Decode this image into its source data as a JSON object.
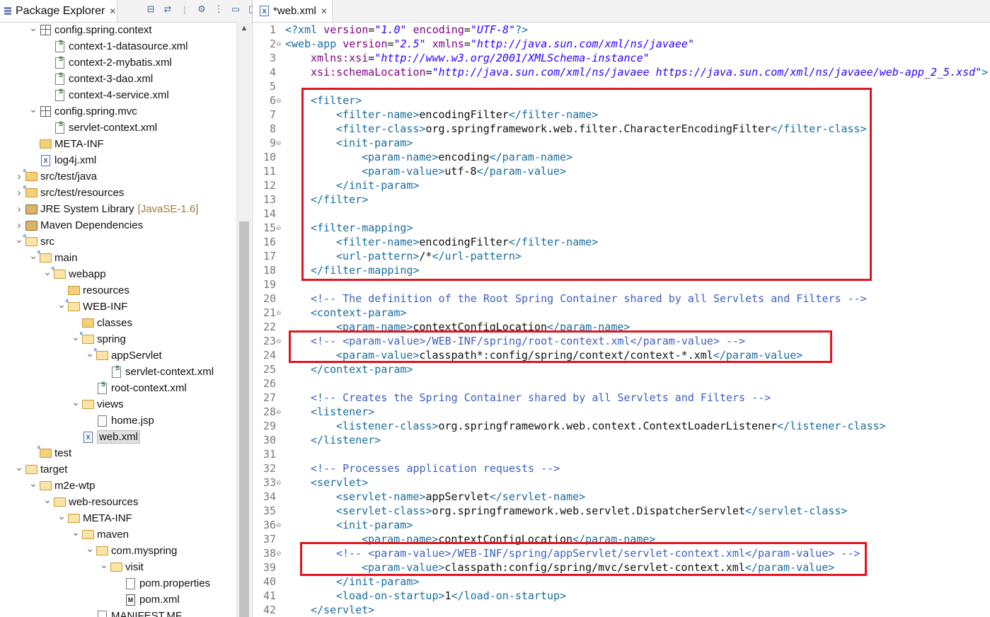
{
  "explorer": {
    "tab_label": "Package Explorer",
    "tab_close": "✕",
    "rows": [
      {
        "label": "config.spring.context",
        "indent": 1,
        "tw": "open",
        "icon": "package"
      },
      {
        "label": "context-1-datasource.xml",
        "indent": 2,
        "tw": "",
        "icon": "spring-xml"
      },
      {
        "label": "context-2-mybatis.xml",
        "indent": 2,
        "tw": "",
        "icon": "spring-xml"
      },
      {
        "label": "context-3-dao.xml",
        "indent": 2,
        "tw": "",
        "icon": "spring-xml"
      },
      {
        "label": "context-4-service.xml",
        "indent": 2,
        "tw": "",
        "icon": "spring-xml"
      },
      {
        "label": "config.spring.mvc",
        "indent": 1,
        "tw": "open",
        "icon": "package"
      },
      {
        "label": "servlet-context.xml",
        "indent": 2,
        "tw": "",
        "icon": "spring-xml"
      },
      {
        "label": "META-INF",
        "indent": 1,
        "tw": "",
        "icon": "folder"
      },
      {
        "label": "log4j.xml",
        "indent": 1,
        "tw": "",
        "icon": "xml"
      },
      {
        "label": "src/test/java",
        "indent": 0,
        "tw": "closed",
        "icon": "src-folder"
      },
      {
        "label": "src/test/resources",
        "indent": 0,
        "tw": "closed",
        "icon": "src-folder"
      },
      {
        "label": "JRE System Library",
        "deco": "[JavaSE-1.6]",
        "indent": 0,
        "tw": "closed",
        "icon": "library"
      },
      {
        "label": "Maven Dependencies",
        "indent": 0,
        "tw": "closed",
        "icon": "library"
      },
      {
        "label": "src",
        "indent": 0,
        "tw": "open",
        "icon": "src-folder"
      },
      {
        "label": "main",
        "indent": 1,
        "tw": "open",
        "icon": "src-folder"
      },
      {
        "label": "webapp",
        "indent": 2,
        "tw": "open",
        "icon": "src-folder"
      },
      {
        "label": "resources",
        "indent": 3,
        "tw": "",
        "icon": "folder"
      },
      {
        "label": "WEB-INF",
        "indent": 3,
        "tw": "open",
        "icon": "src-folder"
      },
      {
        "label": "classes",
        "indent": 4,
        "tw": "",
        "icon": "folder"
      },
      {
        "label": "spring",
        "indent": 4,
        "tw": "open",
        "icon": "src-folder"
      },
      {
        "label": "appServlet",
        "indent": 5,
        "tw": "open",
        "icon": "src-folder"
      },
      {
        "label": "servlet-context.xml",
        "indent": 6,
        "tw": "",
        "icon": "spring-xml"
      },
      {
        "label": "root-context.xml",
        "indent": 5,
        "tw": "",
        "icon": "spring-xml"
      },
      {
        "label": "views",
        "indent": 4,
        "tw": "open",
        "icon": "folder"
      },
      {
        "label": "home.jsp",
        "indent": 5,
        "tw": "",
        "icon": "jsp"
      },
      {
        "label": "web.xml",
        "indent": 4,
        "tw": "",
        "icon": "xml",
        "selected": true
      },
      {
        "label": "test",
        "indent": 1,
        "tw": "",
        "icon": "src-folder"
      },
      {
        "label": "target",
        "indent": 0,
        "tw": "open",
        "icon": "folder"
      },
      {
        "label": "m2e-wtp",
        "indent": 1,
        "tw": "open",
        "icon": "folder"
      },
      {
        "label": "web-resources",
        "indent": 2,
        "tw": "open",
        "icon": "folder"
      },
      {
        "label": "META-INF",
        "indent": 3,
        "tw": "open",
        "icon": "folder"
      },
      {
        "label": "maven",
        "indent": 4,
        "tw": "open",
        "icon": "folder"
      },
      {
        "label": "com.myspring",
        "indent": 5,
        "tw": "open",
        "icon": "folder"
      },
      {
        "label": "visit",
        "indent": 6,
        "tw": "open",
        "icon": "folder"
      },
      {
        "label": "pom.properties",
        "indent": 7,
        "tw": "",
        "icon": "file"
      },
      {
        "label": "pom.xml",
        "indent": 7,
        "tw": "",
        "icon": "maven-xml"
      },
      {
        "label": "MANIFEST.MF",
        "indent": 5,
        "tw": "",
        "icon": "file"
      }
    ]
  },
  "editor": {
    "tab_label": "*web.xml",
    "tab_close": "✕",
    "lines": [
      {
        "n": "1",
        "fold": false,
        "ind": 0,
        "segs": [
          [
            "pi",
            "<?xml "
          ],
          [
            "a",
            "version"
          ],
          [
            "",
            "="
          ],
          [
            "v",
            "\"1.0\""
          ],
          [
            "a",
            " encoding"
          ],
          [
            "",
            "="
          ],
          [
            "v",
            "\"UTF-8\""
          ],
          [
            "pi",
            "?>"
          ]
        ]
      },
      {
        "n": "2",
        "fold": true,
        "ind": 0,
        "segs": [
          [
            "t",
            "<web-app "
          ],
          [
            "a",
            "version"
          ],
          [
            "",
            "="
          ],
          [
            "v",
            "\"2.5\""
          ],
          [
            "a",
            " xmlns"
          ],
          [
            "",
            "="
          ],
          [
            "v",
            "\"http://java.sun.com/xml/ns/javaee\""
          ]
        ]
      },
      {
        "n": "3",
        "fold": false,
        "ind": 4,
        "segs": [
          [
            "a",
            "xmlns:xsi"
          ],
          [
            "",
            "="
          ],
          [
            "v",
            "\"http://www.w3.org/2001/XMLSchema-instance\""
          ]
        ]
      },
      {
        "n": "4",
        "fold": false,
        "ind": 4,
        "segs": [
          [
            "a",
            "xsi:schemaLocation"
          ],
          [
            "",
            "="
          ],
          [
            "v",
            "\"http://java.sun.com/xml/ns/javaee https://java.sun.com/xml/ns/javaee/web-app_2_5.xsd\""
          ],
          [
            "t",
            ">"
          ]
        ]
      },
      {
        "n": "5",
        "fold": false,
        "ind": 0,
        "segs": []
      },
      {
        "n": "6",
        "fold": true,
        "ind": 4,
        "segs": [
          [
            "t",
            "<filter>"
          ]
        ]
      },
      {
        "n": "7",
        "fold": false,
        "ind": 8,
        "segs": [
          [
            "t",
            "<filter-name>"
          ],
          [
            "",
            "encodingFilter"
          ],
          [
            "t",
            "</filter-name>"
          ]
        ]
      },
      {
        "n": "8",
        "fold": false,
        "ind": 8,
        "segs": [
          [
            "t",
            "<filter-class>"
          ],
          [
            "",
            "org.springframework.web.filter.CharacterEncodingFilter"
          ],
          [
            "t",
            "</filter-class>"
          ]
        ]
      },
      {
        "n": "9",
        "fold": true,
        "ind": 8,
        "segs": [
          [
            "t",
            "<init-param>"
          ]
        ]
      },
      {
        "n": "10",
        "fold": false,
        "ind": 12,
        "segs": [
          [
            "t",
            "<param-name>"
          ],
          [
            "",
            "encoding"
          ],
          [
            "t",
            "</param-name>"
          ]
        ]
      },
      {
        "n": "11",
        "fold": false,
        "ind": 12,
        "segs": [
          [
            "t",
            "<param-value>"
          ],
          [
            "",
            "utf-8"
          ],
          [
            "t",
            "</param-value>"
          ]
        ]
      },
      {
        "n": "12",
        "fold": false,
        "ind": 8,
        "segs": [
          [
            "t",
            "</init-param>"
          ]
        ]
      },
      {
        "n": "13",
        "fold": false,
        "ind": 4,
        "segs": [
          [
            "t",
            "</filter>"
          ]
        ]
      },
      {
        "n": "14",
        "fold": false,
        "ind": 0,
        "segs": []
      },
      {
        "n": "15",
        "fold": true,
        "ind": 4,
        "segs": [
          [
            "t",
            "<filter-mapping>"
          ]
        ]
      },
      {
        "n": "16",
        "fold": false,
        "ind": 8,
        "segs": [
          [
            "t",
            "<filter-name>"
          ],
          [
            "",
            "encodingFilter"
          ],
          [
            "t",
            "</filter-name>"
          ]
        ]
      },
      {
        "n": "17",
        "fold": false,
        "ind": 8,
        "segs": [
          [
            "t",
            "<url-pattern>"
          ],
          [
            "",
            "/*"
          ],
          [
            "t",
            "</url-pattern>"
          ]
        ]
      },
      {
        "n": "18",
        "fold": false,
        "ind": 4,
        "segs": [
          [
            "t",
            "</filter-mapping>"
          ]
        ]
      },
      {
        "n": "19",
        "fold": false,
        "ind": 0,
        "segs": []
      },
      {
        "n": "20",
        "fold": false,
        "ind": 4,
        "segs": [
          [
            "c",
            "<!-- The definition of the Root Spring Container shared by all Servlets and Filters -->"
          ]
        ]
      },
      {
        "n": "21",
        "fold": true,
        "ind": 4,
        "segs": [
          [
            "t",
            "<context-param>"
          ]
        ]
      },
      {
        "n": "22",
        "fold": false,
        "ind": 8,
        "segs": [
          [
            "t",
            "<param-name>"
          ],
          [
            "",
            "contextConfigLocation"
          ],
          [
            "t",
            "</param-name>"
          ]
        ]
      },
      {
        "n": "23",
        "fold": true,
        "ind": 4,
        "segs": [
          [
            "c",
            "<!-- <param-value>/WEB-INF/spring/root-context.xml</param-value> -->"
          ]
        ]
      },
      {
        "n": "24",
        "fold": false,
        "ind": 8,
        "segs": [
          [
            "t",
            "<param-value>"
          ],
          [
            "",
            "classpath*:config/spring/context/context-*.xml"
          ],
          [
            "t",
            "</param-value>"
          ]
        ]
      },
      {
        "n": "25",
        "fold": false,
        "ind": 4,
        "segs": [
          [
            "t",
            "</context-param>"
          ]
        ]
      },
      {
        "n": "26",
        "fold": false,
        "ind": 0,
        "segs": []
      },
      {
        "n": "27",
        "fold": false,
        "ind": 4,
        "segs": [
          [
            "c",
            "<!-- Creates the Spring Container shared by all Servlets and Filters -->"
          ]
        ]
      },
      {
        "n": "28",
        "fold": true,
        "ind": 4,
        "segs": [
          [
            "t",
            "<listener>"
          ]
        ]
      },
      {
        "n": "29",
        "fold": false,
        "ind": 8,
        "segs": [
          [
            "t",
            "<listener-class>"
          ],
          [
            "",
            "org.springframework.web.context.ContextLoaderListener"
          ],
          [
            "t",
            "</listener-class>"
          ]
        ]
      },
      {
        "n": "30",
        "fold": false,
        "ind": 4,
        "segs": [
          [
            "t",
            "</listener>"
          ]
        ]
      },
      {
        "n": "31",
        "fold": false,
        "ind": 0,
        "segs": []
      },
      {
        "n": "32",
        "fold": false,
        "ind": 4,
        "segs": [
          [
            "c",
            "<!-- Processes application requests -->"
          ]
        ]
      },
      {
        "n": "33",
        "fold": true,
        "ind": 4,
        "segs": [
          [
            "t",
            "<servlet>"
          ]
        ]
      },
      {
        "n": "34",
        "fold": false,
        "ind": 8,
        "segs": [
          [
            "t",
            "<servlet-name>"
          ],
          [
            "",
            "appServlet"
          ],
          [
            "t",
            "</servlet-name>"
          ]
        ]
      },
      {
        "n": "35",
        "fold": false,
        "ind": 8,
        "segs": [
          [
            "t",
            "<servlet-class>"
          ],
          [
            "",
            "org.springframework.web.servlet.DispatcherServlet"
          ],
          [
            "t",
            "</servlet-class>"
          ]
        ]
      },
      {
        "n": "36",
        "fold": true,
        "ind": 8,
        "segs": [
          [
            "t",
            "<init-param>"
          ]
        ]
      },
      {
        "n": "37",
        "fold": false,
        "ind": 12,
        "segs": [
          [
            "t",
            "<param-name>"
          ],
          [
            "",
            "contextConfigLocation"
          ],
          [
            "t",
            "</param-name>"
          ]
        ]
      },
      {
        "n": "38",
        "fold": true,
        "ind": 8,
        "segs": [
          [
            "c",
            "<!-- <param-value>/WEB-INF/spring/appServlet/servlet-context.xml</param-value> -->"
          ]
        ]
      },
      {
        "n": "39",
        "fold": false,
        "ind": 12,
        "segs": [
          [
            "t",
            "<param-value>"
          ],
          [
            "",
            "classpath:config/spring/mvc/servlet-context.xml"
          ],
          [
            "t",
            "</param-value>"
          ]
        ]
      },
      {
        "n": "40",
        "fold": false,
        "ind": 8,
        "segs": [
          [
            "t",
            "</init-param>"
          ]
        ]
      },
      {
        "n": "41",
        "fold": false,
        "ind": 8,
        "segs": [
          [
            "t",
            "<load-on-startup>"
          ],
          [
            "",
            "1"
          ],
          [
            "t",
            "</load-on-startup>"
          ]
        ]
      },
      {
        "n": "42",
        "fold": false,
        "ind": 4,
        "segs": [
          [
            "t",
            "</servlet>"
          ]
        ]
      }
    ]
  },
  "colors": {
    "highlight_box": "#e3141f",
    "tag": "#1a6c9c",
    "attr": "#7f007f",
    "value": "#2a00ff",
    "comment": "#3f5fbf"
  }
}
